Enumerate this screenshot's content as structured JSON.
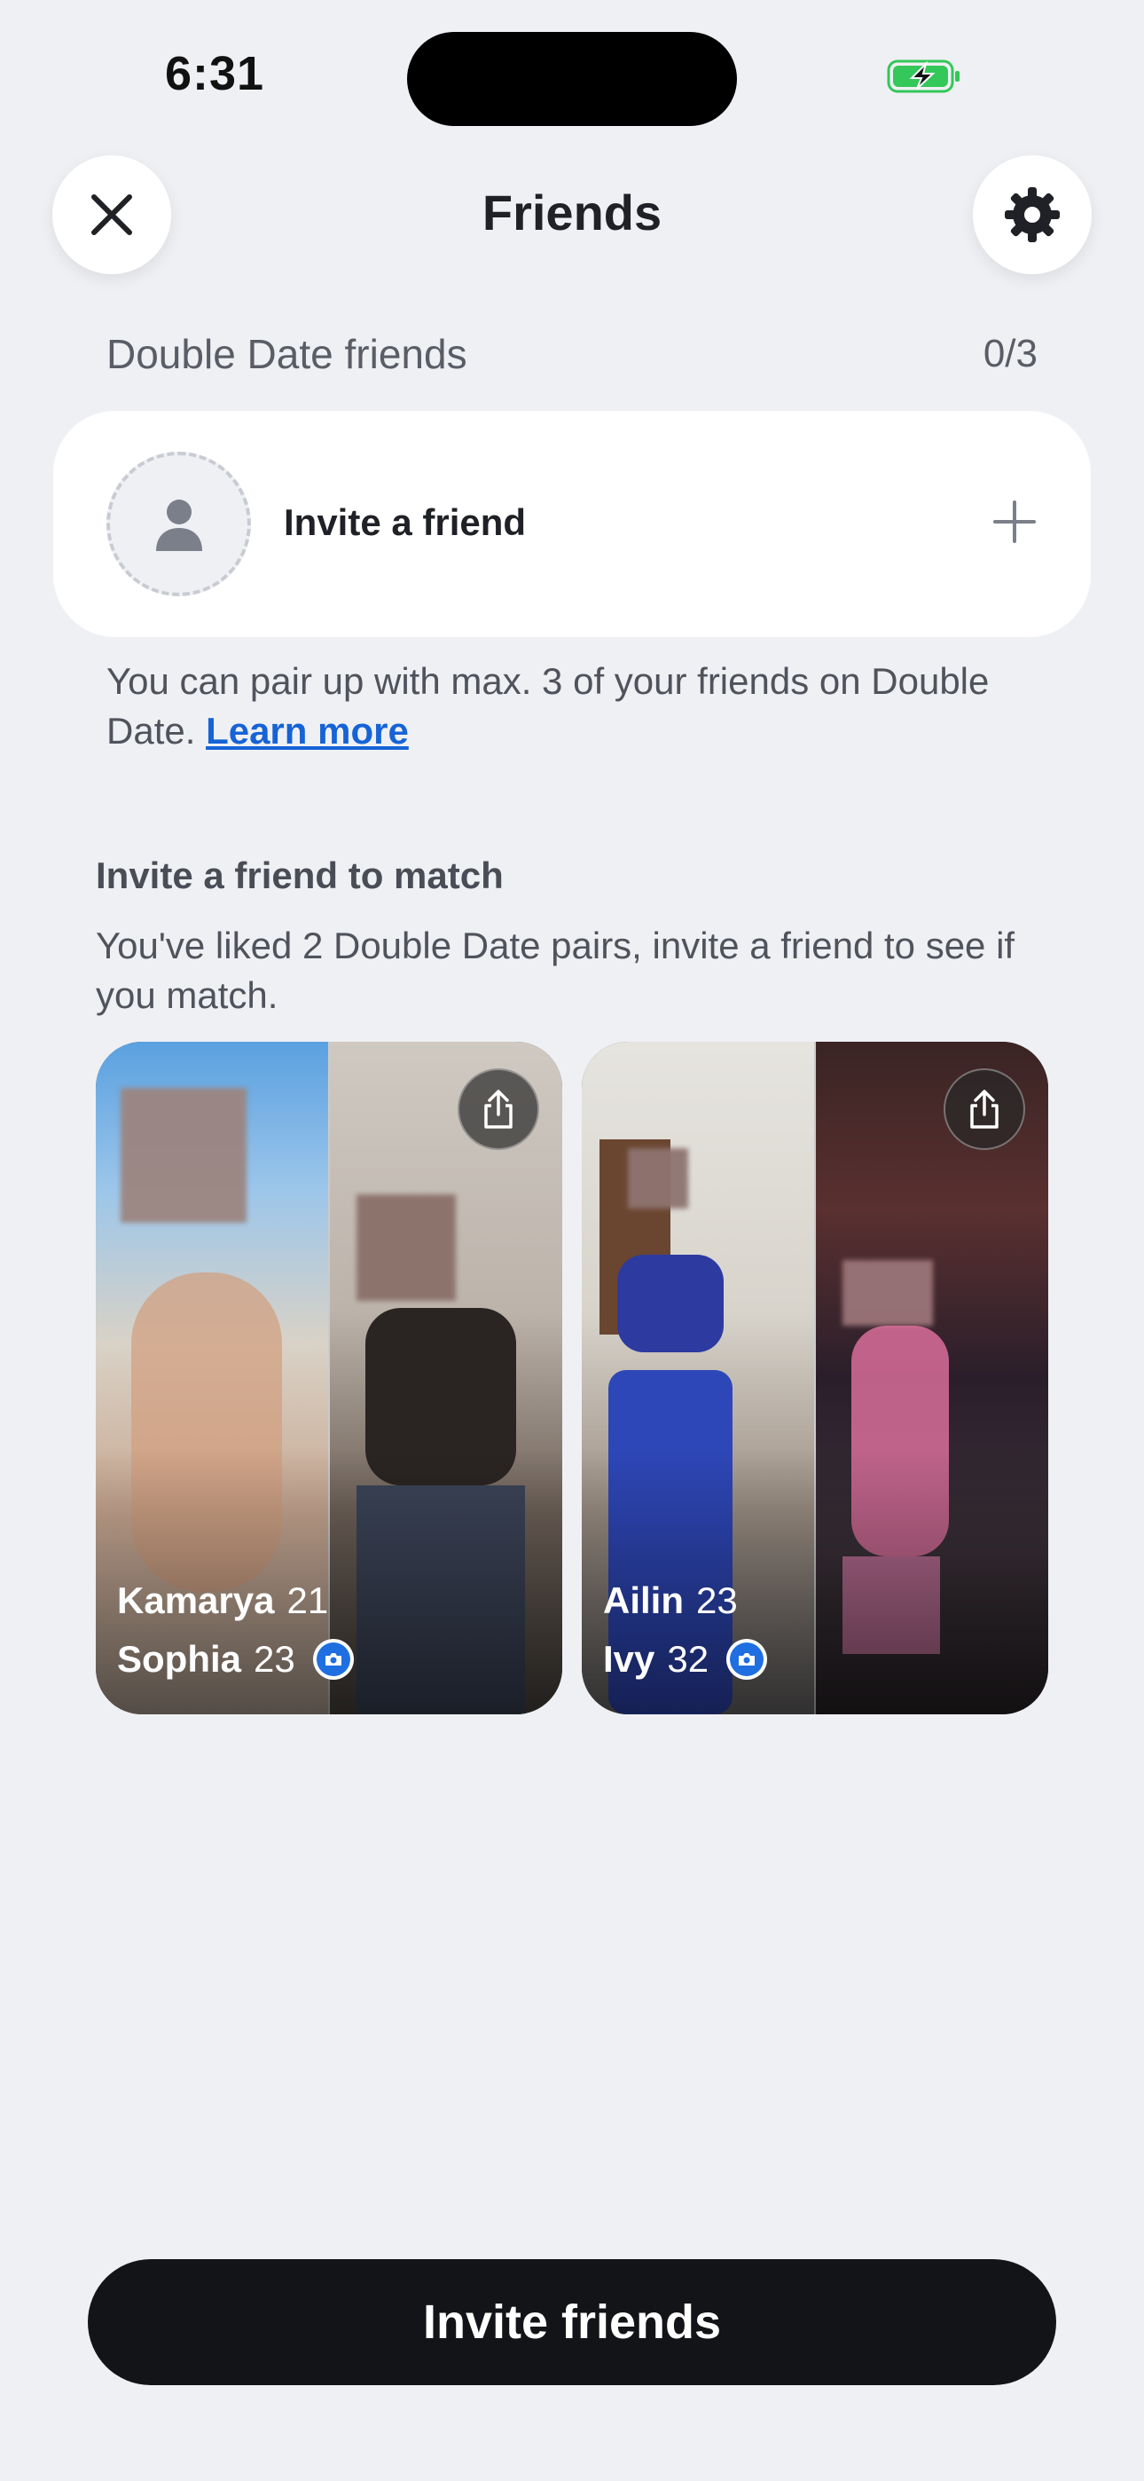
{
  "status_bar": {
    "time": "6:31"
  },
  "header": {
    "title": "Friends"
  },
  "double_date": {
    "label": "Double Date friends",
    "count": "0/3",
    "invite_label": "Invite a friend",
    "info_text": "You can pair up with max. 3 of your friends on Double Date.",
    "learn_more": "Learn more"
  },
  "match_section": {
    "title": "Invite a friend to match",
    "description": "You've liked 2 Double Date pairs, invite a friend to see if you match.",
    "pairs": [
      {
        "person1": {
          "name": "Kamarya",
          "age": "21"
        },
        "person2": {
          "name": "Sophia",
          "age": "23"
        }
      },
      {
        "person1": {
          "name": "Ailin",
          "age": "23"
        },
        "person2": {
          "name": "Ivy",
          "age": "32"
        }
      }
    ]
  },
  "cta": {
    "label": "Invite friends"
  },
  "colors": {
    "accent_link": "#1663d6",
    "verified_badge": "#1f6fe0",
    "cta_bg": "#131417",
    "battery_green": "#34c759"
  }
}
